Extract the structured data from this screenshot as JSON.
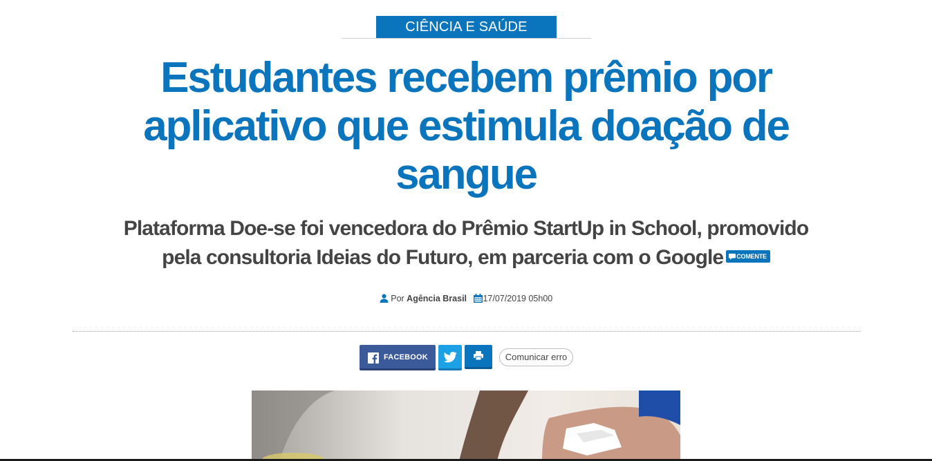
{
  "category": {
    "label": "CIÊNCIA E SAÚDE"
  },
  "article": {
    "title": "Estudantes recebem prêmio por aplicativo que estimula doação de sangue",
    "subtitle": "Plataforma Doe-se foi vencedora do Prêmio StartUp in School, promovido pela consultoria Ideias do Futuro, em parceria com o Google",
    "comment_label": "COMENTE"
  },
  "byline": {
    "prefix": "Por",
    "author": "Agência Brasil",
    "datetime": "17/07/2019 05h00"
  },
  "share": {
    "facebook_label": "FACEBOOK",
    "report_label": "Comunicar erro"
  },
  "colors": {
    "brand_blue": "#0a74bd",
    "facebook": "#3b5a99",
    "twitter": "#1da1e6"
  },
  "icons": [
    "user-icon",
    "calendar-icon",
    "comment-icon",
    "facebook-icon",
    "twitter-icon",
    "print-icon"
  ]
}
